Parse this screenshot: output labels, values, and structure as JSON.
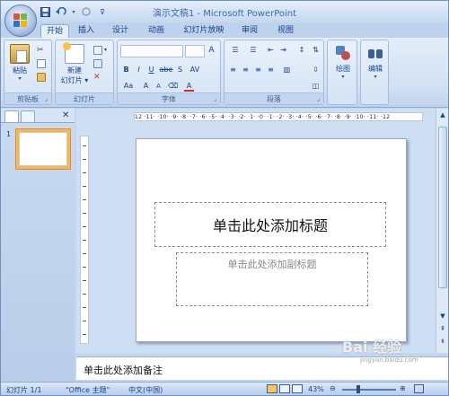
{
  "window": {
    "title": "演示文稿1 - Microsoft PowerPoint"
  },
  "quick_access": {
    "icons": [
      "save-icon",
      "undo-icon",
      "redo-icon",
      "customize-icon"
    ]
  },
  "tabs": [
    "开始",
    "插入",
    "设计",
    "动画",
    "幻灯片放映",
    "审阅",
    "视图"
  ],
  "ribbon": {
    "clipboard": {
      "label": "剪贴板",
      "paste": "粘贴"
    },
    "slides": {
      "label": "幻灯片",
      "new_slide_1": "新建",
      "new_slide_2": "幻灯片"
    },
    "font": {
      "label": "字体",
      "bold": "B",
      "italic": "I",
      "underline": "U",
      "strike": "abe",
      "shadow": "S",
      "spacing": "AV",
      "case": "Aa",
      "grow": "A",
      "shrink": "A",
      "color": "A"
    },
    "paragraph": {
      "label": "段落"
    },
    "drawing": {
      "label": "绘图"
    },
    "editing": {
      "label": "编辑"
    }
  },
  "ruler_text": "12 ·11· ·10· ·9· ·8· ·7· ·6· ·5· ·4· ·3· ·2· ·1· ·0· ·1· ·2· ·3· ·4· ·5· ·6· ·7· ·8· ·9· ·10· ·11· ·12",
  "slide_pane": {
    "slide_number": "1"
  },
  "slide": {
    "title_placeholder": "单击此处添加标题",
    "subtitle_placeholder": "单击此处添加副标题"
  },
  "notes": {
    "placeholder": "单击此处添加备注"
  },
  "status_bar": {
    "slide_count": "幻灯片 1/1",
    "theme": "\"Office 主题\"",
    "language": "中文(中国)",
    "zoom": "43%"
  },
  "watermark": {
    "text": "Bai 经验",
    "url": "jingyan.baidu.com"
  },
  "colors": {
    "accent": "#15428b",
    "ribbon_bg": "#d3e1f3",
    "selected_thumb": "#f6b65b"
  }
}
